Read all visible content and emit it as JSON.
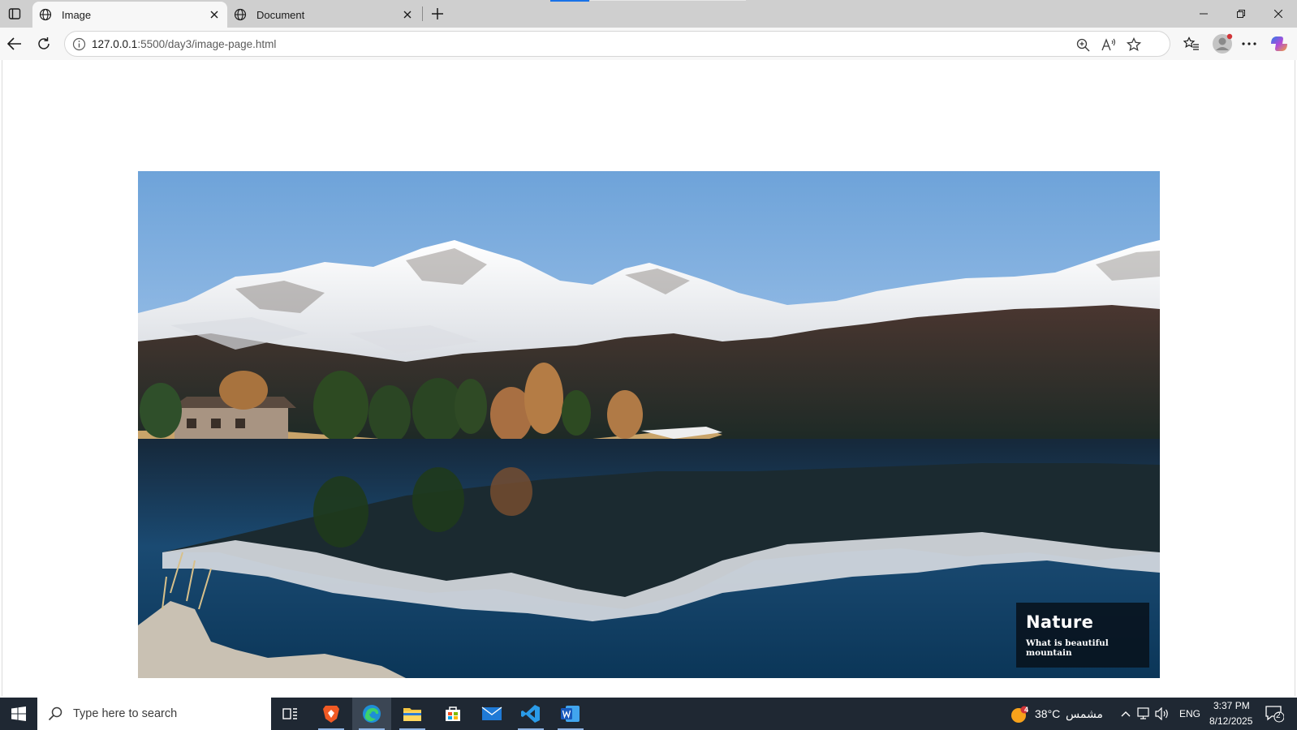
{
  "browser": {
    "tabs": [
      {
        "title": "Image",
        "active": true
      },
      {
        "title": "Document",
        "active": false
      }
    ],
    "address_bar": {
      "host": "127.0.0.1",
      "rest": ":5500/day3/image-page.html"
    }
  },
  "page": {
    "caption": {
      "title": "Nature",
      "subtitle": "What is beautiful mountain"
    }
  },
  "taskbar": {
    "search_placeholder": "Type here to search",
    "weather": {
      "temp": "38°C",
      "condition": "مشمس",
      "badge": "4"
    },
    "language": "ENG",
    "time": "3:37 PM",
    "date": "8/12/2025",
    "notification_count": "2"
  },
  "colors": {
    "taskbar_bg": "#1f2833",
    "tabbar_bg": "#cfcfcf",
    "toolbar_bg": "#f7f7f7",
    "caption_bg": "#08121c"
  }
}
